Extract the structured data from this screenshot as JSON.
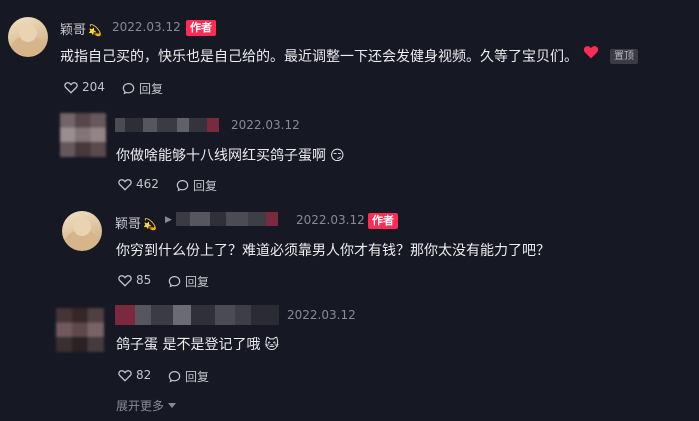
{
  "comments": [
    {
      "author": "颖哥",
      "author_emoji": "💫",
      "date": "2022.03.12",
      "badge": "作者",
      "text": "戒指自己买的，快乐也是自己给的。最近调整一下还会发健身视频。久等了宝贝们。",
      "pinned_label": "置顶",
      "likes": "204",
      "reply_label": "回复"
    },
    {
      "author": "",
      "date": "2022.03.12",
      "text": "你做啥能够十八线网红买鸽子蛋啊",
      "text_emoji": "😏",
      "likes": "462",
      "reply_label": "回复"
    },
    {
      "author": "颖哥",
      "author_emoji": "💫",
      "date": "2022.03.12",
      "badge": "作者",
      "text": "你穷到什么份上了？难道必须靠男人你才有钱？那你太没有能力了吧？",
      "likes": "85",
      "reply_label": "回复"
    },
    {
      "author": "",
      "date": "2022.03.12",
      "text": "鸽子蛋 是不是登记了哦",
      "text_emoji": "🐱",
      "likes": "82",
      "reply_label": "回复"
    }
  ],
  "expand_more": "展开更多",
  "colors": {
    "background": "#161823",
    "accent": "#fe2c55",
    "heart": "#fe2c55"
  },
  "icons": {
    "like": "heart-outline-icon",
    "reply": "comment-bubble-icon",
    "pinned_heart": "heart-filled-icon",
    "expand": "chevron-down-icon"
  }
}
